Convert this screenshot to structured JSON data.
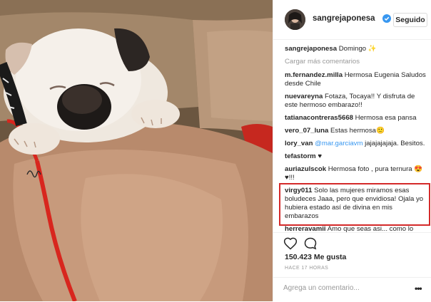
{
  "post": {
    "username": "sangrejaponesa",
    "follow_label": "Seguido",
    "caption_user": "sangrejaponesa",
    "caption_text": "Domingo ✨",
    "load_more": "Cargar más comentarios",
    "comments": [
      {
        "user": "m.fernandez.milla",
        "text": "Hermosa Eugenia Saludos desde Chile"
      },
      {
        "user": "nuevareyna",
        "text": "Fotaza, Tocaya!! Y disfruta de este hermoso embarazo!!"
      },
      {
        "user": "tatianacontreras5668",
        "text": "Hermosa esa pansa"
      },
      {
        "user": "vero_07_luna",
        "text": "Estas hermosa🙂"
      },
      {
        "user": "lory_van",
        "mention": "@mar.garciavm",
        "text": "jajajajajaja. Besitos."
      },
      {
        "user": "tefastorm",
        "text": "♥"
      },
      {
        "user": "auriazulscok",
        "text": "Hermosa foto , pura ternura 😍♥!!!"
      },
      {
        "user": "virgy011",
        "text": "Solo las mujeres miramos esas boludeces Jaaa, pero que envidiosa! Ojala yo hubiera estado así de divina en mis embarazos"
      },
      {
        "user": "herreravamii",
        "text": "Amo que seas asi... como lo"
      }
    ],
    "likes": "150.423 Me gusta",
    "timestamp": "HACE 17 HORAS",
    "comment_placeholder": "Agrega un comentario...",
    "more_label": "•••"
  },
  "colors": {
    "highlight": "#d42a2a",
    "verified": "#3897f0",
    "link": "#3897f0"
  },
  "icons": [
    "verified-badge-icon",
    "heart-icon",
    "comment-icon",
    "more-options-icon"
  ]
}
